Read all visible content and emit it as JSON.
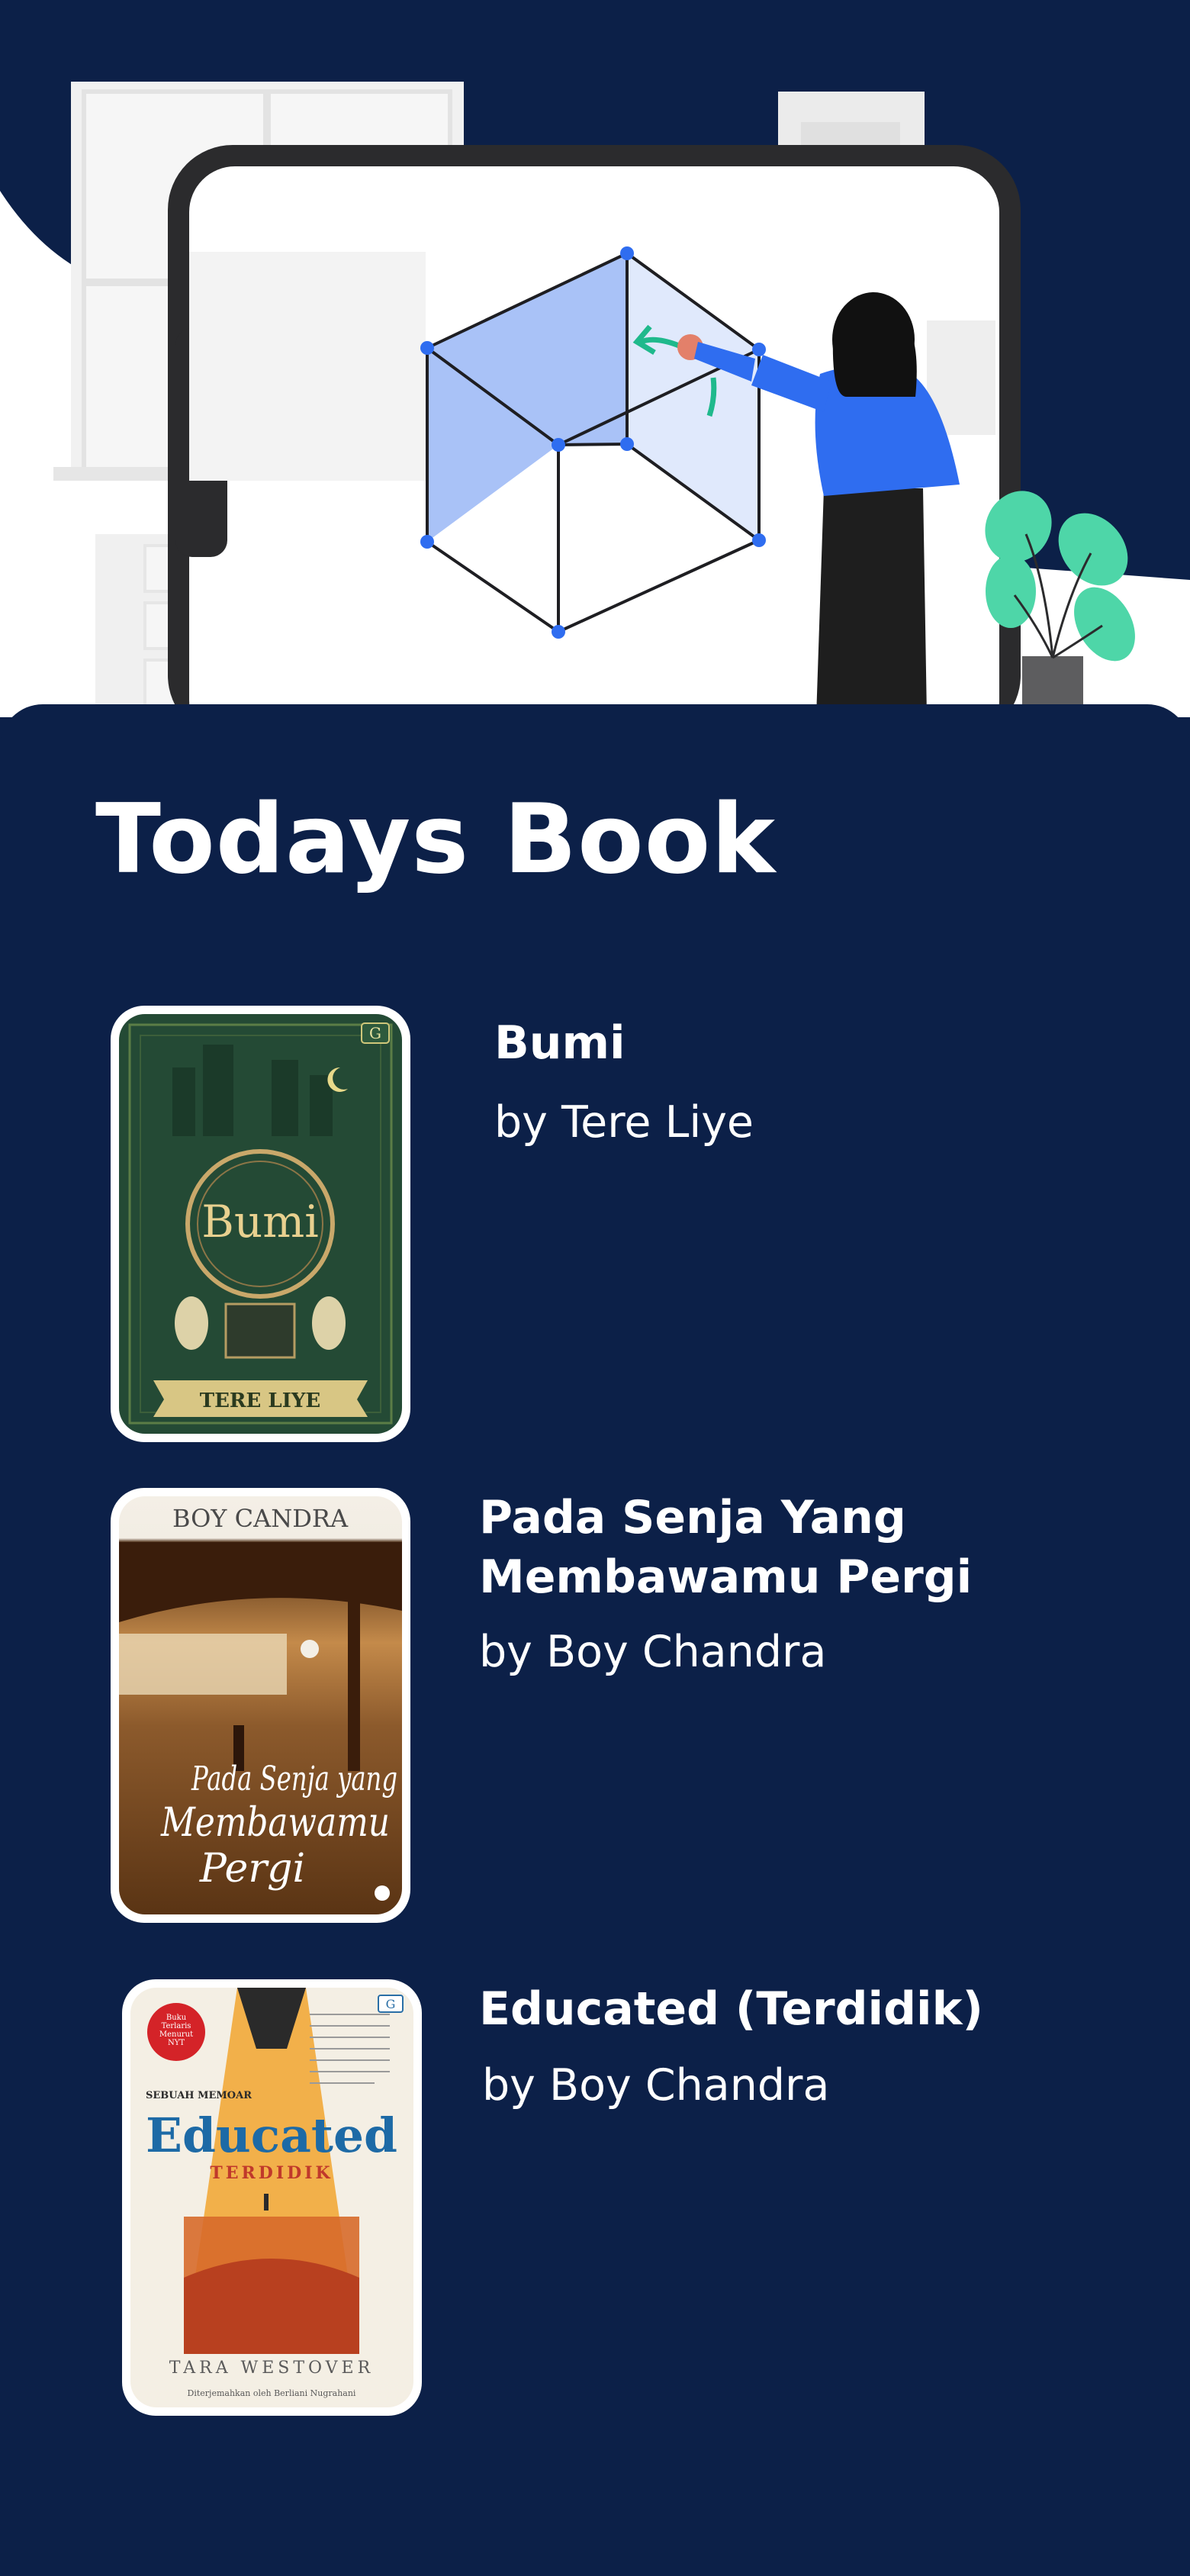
{
  "screen": {
    "title": "Todays Book"
  },
  "colors": {
    "background": "#0c2048",
    "text": "#ffffff",
    "accent_blue": "#2f6df0",
    "plant_green": "#4ed6a8"
  },
  "books": [
    {
      "title": "Bumi",
      "author": "by Tere Liye",
      "cover": {
        "publisher_mark": "G",
        "title_art": "Bumi",
        "author_art": "TERE LIYE"
      }
    },
    {
      "title": "Pada Senja Yang Membawamu Pergi",
      "author": "by Boy Chandra",
      "cover": {
        "author_art": "BOY CANDRA",
        "title_line1": "Pada Senja yang",
        "title_line2": "Membawamu",
        "title_line3": "Pergi"
      }
    },
    {
      "title": "Educated (Terdidik)",
      "author": "by Boy Chandra",
      "cover": {
        "badge": "Buku Terlaris Menurut New York Times",
        "kicker": "SEBUAH MEMOAR",
        "title_art": "Educated",
        "subtitle_art": "TERDIDIK",
        "author_art": "TARA WESTOVER",
        "translator": "Diterjemahkan oleh Berliani Nugrahani",
        "publisher_mark": "G"
      }
    }
  ]
}
